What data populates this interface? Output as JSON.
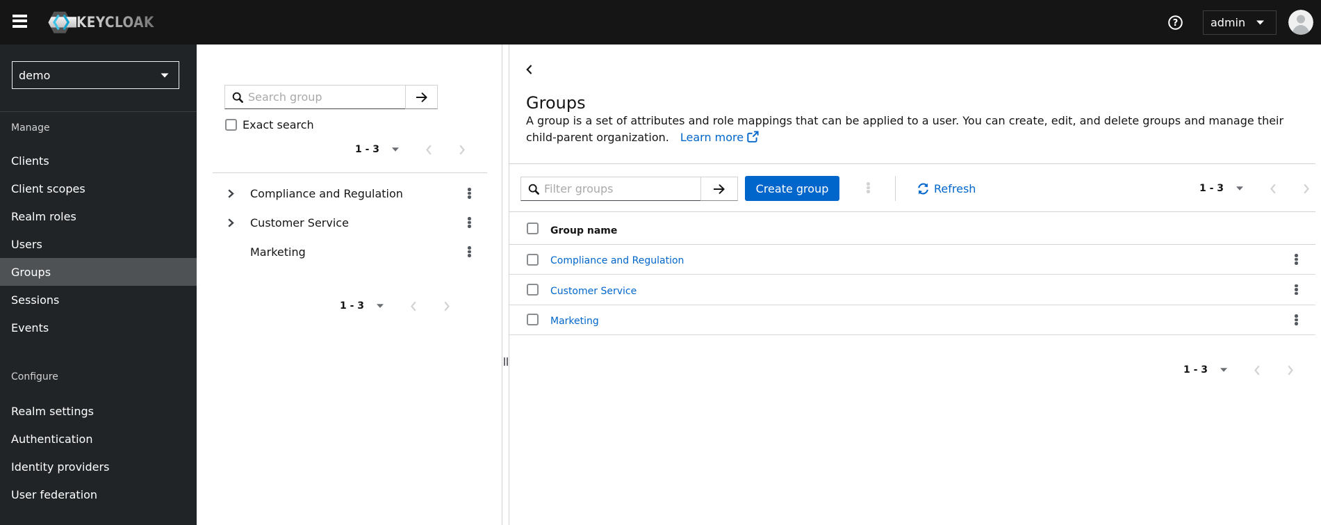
{
  "colors": {
    "masthead_bg": "#151515",
    "sidebar_bg": "#212427",
    "nav_selected_bg": "#4f5255",
    "primary_blue": "#0066cc",
    "border": "#d2d2d2",
    "text": "#151515"
  },
  "masthead": {
    "brand": "KEYCLOAK",
    "user": "admin"
  },
  "sidebar": {
    "realm": "demo",
    "sections": [
      {
        "label": "Manage",
        "items": [
          {
            "label": "Clients"
          },
          {
            "label": "Client scopes"
          },
          {
            "label": "Realm roles"
          },
          {
            "label": "Users"
          },
          {
            "label": "Groups"
          },
          {
            "label": "Sessions"
          },
          {
            "label": "Events"
          }
        ]
      },
      {
        "label": "Configure",
        "items": [
          {
            "label": "Realm settings"
          },
          {
            "label": "Authentication"
          },
          {
            "label": "Identity providers"
          },
          {
            "label": "User federation"
          }
        ]
      }
    ],
    "selected_item": "Groups"
  },
  "tree_panel": {
    "search_placeholder": "Search group",
    "exact_search_label": "Exact search",
    "pagination_top": "1 - 3",
    "items": [
      {
        "label": "Compliance and Regulation",
        "expandable": true
      },
      {
        "label": "Customer Service",
        "expandable": true
      },
      {
        "label": "Marketing",
        "expandable": false
      }
    ],
    "pagination_bottom": "1 - 3"
  },
  "main": {
    "title": "Groups",
    "description": "A group is a set of attributes and role mappings that can be applied to a user. You can create, edit, and delete groups and manage their child-parent organization.",
    "learn_more_label": "Learn more",
    "toolbar": {
      "filter_placeholder": "Filter groups",
      "create_button_label": "Create group",
      "refresh_label": "Refresh",
      "pagination": "1 - 3"
    },
    "table": {
      "column_header": "Group name",
      "rows": [
        {
          "name": "Compliance and Regulation"
        },
        {
          "name": "Customer Service"
        },
        {
          "name": "Marketing"
        }
      ],
      "pagination": "1 - 3"
    }
  }
}
